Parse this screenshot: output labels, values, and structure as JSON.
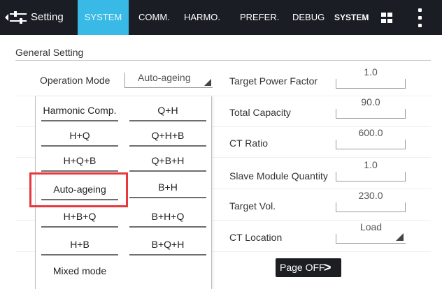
{
  "topbar": {
    "title": "Setting",
    "tabs": [
      {
        "label": "SYSTEM",
        "active": true
      },
      {
        "label": "COMM."
      },
      {
        "label": "HARMO."
      },
      {
        "label": "PREFER."
      },
      {
        "label": "DEBUG"
      },
      {
        "label": "SYSTEM"
      }
    ],
    "icons": [
      "settings-sliders-icon",
      "grid-icon",
      "kebab-menu-icon"
    ],
    "colors": {
      "bar": "#1a1d24",
      "active_tab": "#39b9e5"
    }
  },
  "section": {
    "title": "General Setting"
  },
  "operation_mode": {
    "label": "Operation Mode",
    "value": "Auto-ageing"
  },
  "dropdown": {
    "options": [
      "Harmonic Comp.",
      "Q+H",
      "H+Q",
      "Q+H+B",
      "H+Q+B",
      "Q+B+H",
      "Auto-ageing",
      "B+H",
      "H+B+Q",
      "B+H+Q",
      "H+B",
      "B+Q+H",
      "Mixed mode"
    ],
    "highlighted": "Auto-ageing",
    "highlight_color": "#e8383d"
  },
  "settings": [
    {
      "label": "Target Power Factor",
      "value": "1.0"
    },
    {
      "label": "Total Capacity",
      "value": "90.0"
    },
    {
      "label": "CT Ratio",
      "value": "600.0"
    },
    {
      "label": "Slave Module Quantity",
      "value": "1.0"
    },
    {
      "label": "Target Vol.",
      "value": "230.0"
    },
    {
      "label": "CT Location",
      "value": "Load"
    }
  ],
  "page_button": {
    "label": "Page OFF",
    "arrow": ">"
  }
}
